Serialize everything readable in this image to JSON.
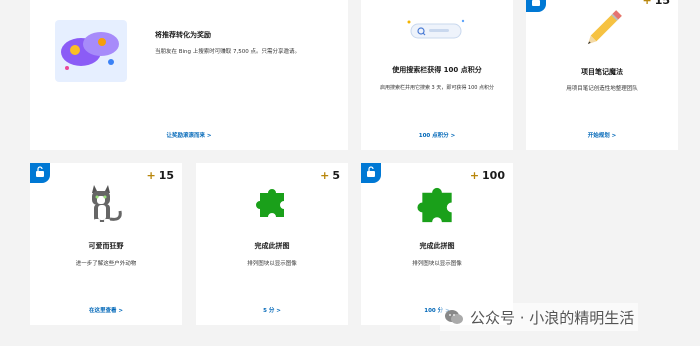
{
  "cards": [
    {
      "title": "将推荐转化为奖励",
      "desc": "当朋友在 Bing 上搜索时可赚取 7,500 点。只需分享邀请。",
      "link": "让奖励滚滚而来 >"
    },
    {
      "title": "使用搜索栏获得 100 点积分",
      "desc": "启用搜索栏并用它搜索 3 天，即可获得 100 点积分",
      "link": "100 点积分 >"
    },
    {
      "title": "项目笔记魔法",
      "desc": "用项目笔记创造性地整理团队",
      "link": "开始规划 >",
      "points": "15"
    },
    {
      "title": "可爱而狂野",
      "desc": "进一步了解这些户外动物",
      "link": "在这里查看 >",
      "points": "15"
    },
    {
      "title": "完成此拼图",
      "desc": "排列图块以显示图像",
      "link": "5 分 >",
      "points": "5"
    },
    {
      "title": "完成此拼图",
      "desc": "排列图块以显示图像",
      "link": "100 分 >",
      "points": "100"
    }
  ],
  "watermark": {
    "text": "公众号 · 小浪的精明生活"
  },
  "colors": {
    "accent": "#0078d4",
    "link": "#0067b8",
    "puzzle": "#1aa01a",
    "plus": "#b8860b"
  }
}
